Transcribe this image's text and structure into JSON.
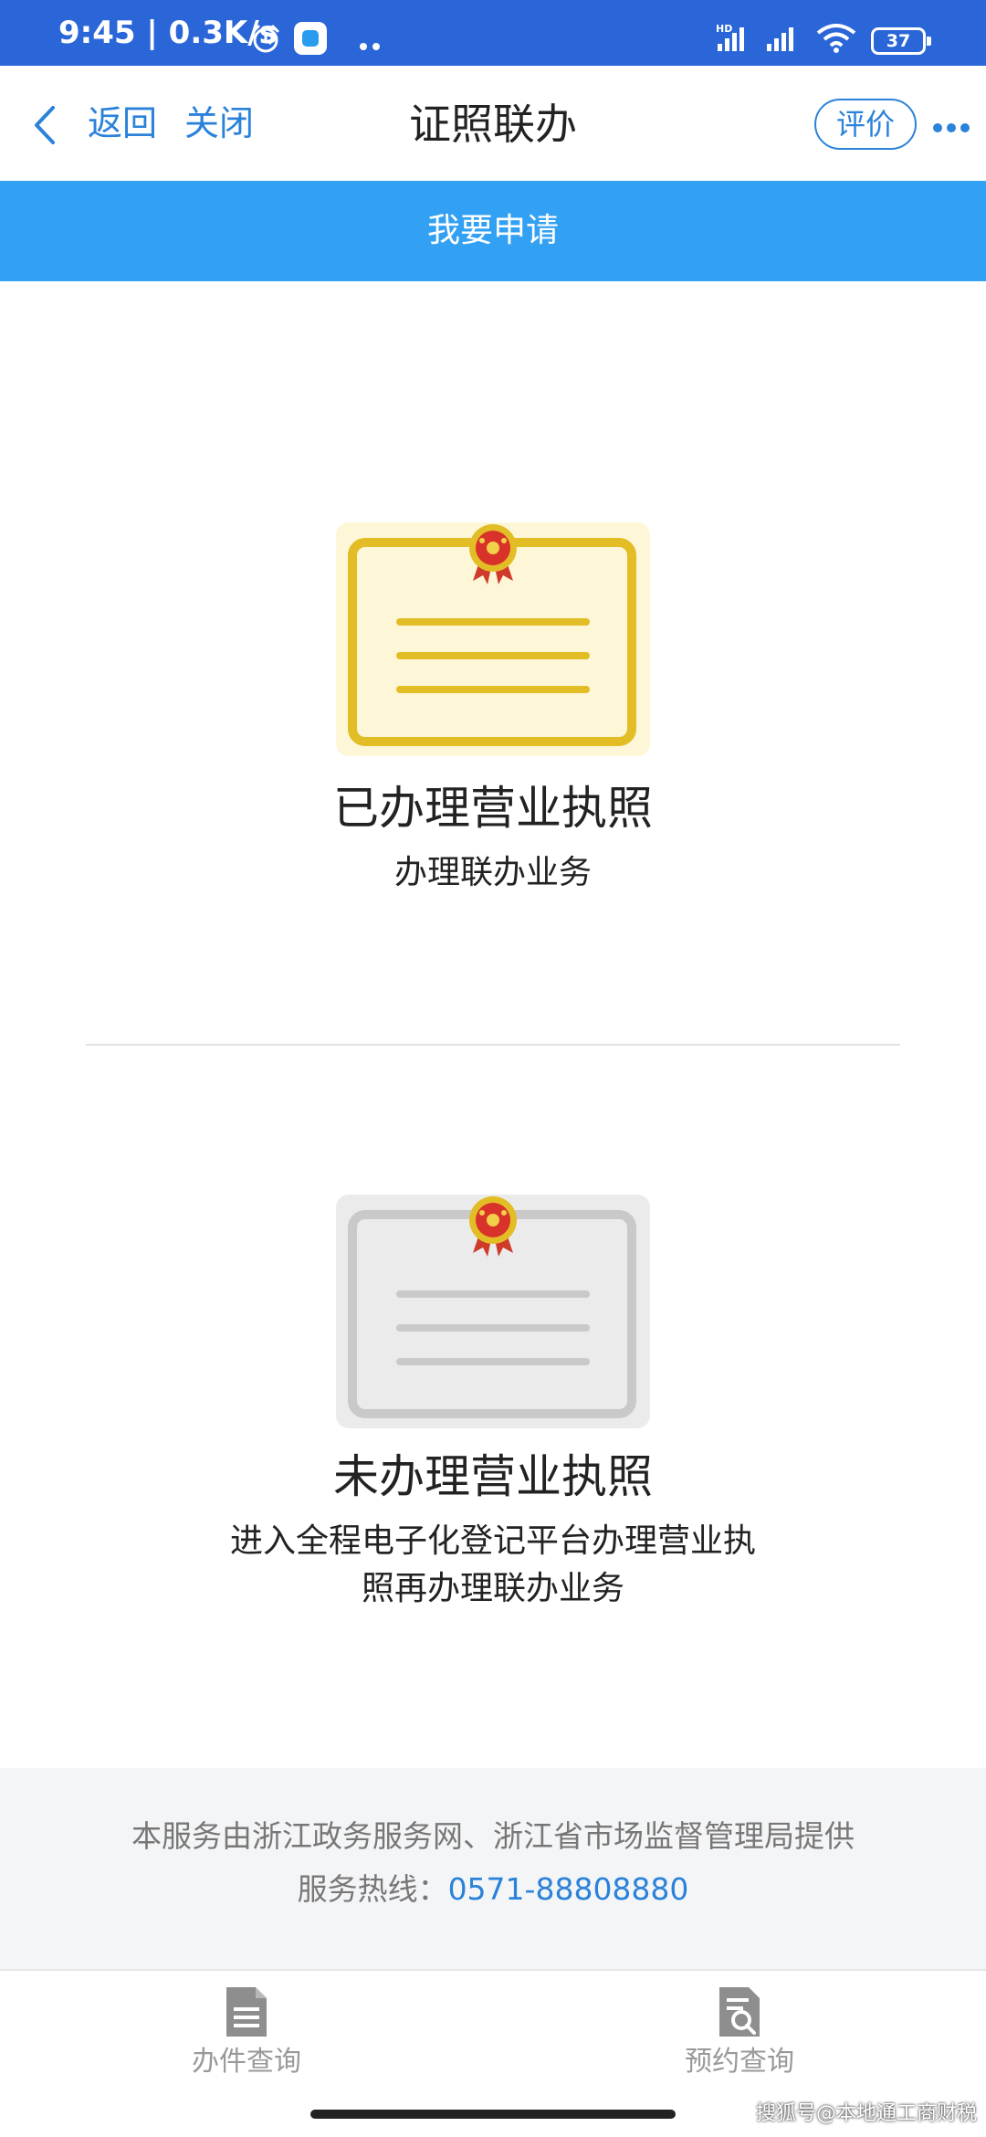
{
  "status_bar": {
    "time_speed": "9:45 | 0.3K/s",
    "network_label": "HD",
    "battery": "37",
    "icons": [
      "alarm-icon",
      "app-notification-icon",
      "signal-icon",
      "wifi-icon",
      "battery-icon"
    ]
  },
  "nav": {
    "back_label": "返回",
    "close_label": "关闭",
    "title": "证照联办",
    "rate_label": "评价",
    "icons": [
      "chevron-left-icon",
      "more-icon"
    ]
  },
  "header": {
    "apply_label": "我要申请"
  },
  "options": [
    {
      "title": "已办理营业执照",
      "subtitle": "办理联办业务",
      "icon": "certificate-icon"
    },
    {
      "title": "未办理营业执照",
      "subtitle": "进入全程电子化登记平台办理营业执照再办理联办业务",
      "icon": "certificate-grey-icon"
    }
  ],
  "footer": {
    "provider": "本服务由浙江政务服务网、浙江省市场监督管理局提供",
    "hotline_label": "服务热线：",
    "hotline_number": "0571-88808880"
  },
  "tabs": [
    {
      "label": "办件查询",
      "icon": "document-icon"
    },
    {
      "label": "预约查询",
      "icon": "search-document-icon"
    }
  ],
  "watermark": "搜狐号@本地通工商财税",
  "colors": {
    "status_bar": "#2a66d8",
    "accent_blue": "#2b82d9",
    "header_blue": "#33a1f3",
    "certificate_gold": "#e2bd25",
    "certificate_grey": "#c9c9c9",
    "footer_bg": "#f4f5f7"
  }
}
